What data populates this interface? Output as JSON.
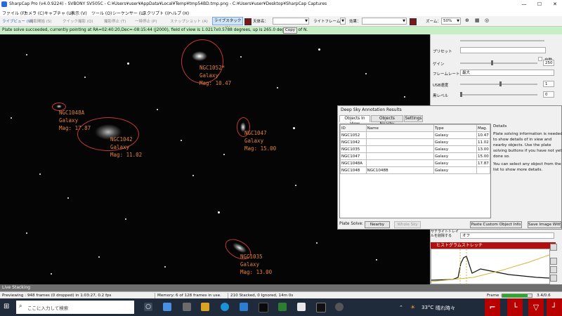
{
  "window": {
    "title": "SharpCap Pro (v4.0.9224) - SVBONY SV505C - C:¥Users¥user¥AppData¥Local¥Temp¥tmp54BD.tmp.png - C:¥Users¥user¥Desktop¥SharpCap Captures",
    "minimize": "—",
    "maximize": "☐",
    "close": "✕"
  },
  "menu": [
    "ファイル (F)",
    "カメラ (C)",
    "キャプチャ (U)",
    "表示 (V)",
    "ツール (O)",
    "シーケンサー (U)",
    "スクリプト (I)",
    "ヘルプ (H)"
  ],
  "toolbar": {
    "live_view": "ライブビュー (W)",
    "capture_start": "撮影開始 (S)",
    "quick_capture": "クイック撮影 (Q)",
    "capture_stop": "撮影停止 (T)",
    "pause": "一時停止 (P)",
    "snapshot": "スナップショット (A)",
    "live_stack": "ライブスタック (L)",
    "target_name": "天体名：",
    "live_frame": "ライトフレーム",
    "effect": "効果：",
    "zoom_label": "ズーム：",
    "zoom_value": "50%"
  },
  "notification": {
    "message": "Plate solve succeeded, currently pointing at RA=02:40:20,Dec=-08:15:44 (J2000), field of view is 1.0217x0.5788 degrees, up is 265.0 degrees E of N.",
    "copy_label": "Copy"
  },
  "annotations": [
    {
      "id": "ngc1052",
      "text": "NGC1052*\nGalaxy\nMag: 10.47"
    },
    {
      "id": "ngc1048a",
      "text": "NGC1048A\nGalaxy\nMag: 17.87"
    },
    {
      "id": "ngc1042",
      "text": "NGC1042\nGalaxy\nMag: 11.02"
    },
    {
      "id": "ngc1047",
      "text": "NGC1047\nGalaxy\nMag: 15.00"
    },
    {
      "id": "ngc1035",
      "text": "NGC1035\nGalaxy\nMag: 13.00"
    }
  ],
  "right_panel": {
    "preset_label": "プリセット",
    "auto_label": "自動",
    "gain_label": "ゲイン",
    "gain_value": "250",
    "frame_rate_label": "フレームレート",
    "frame_rate_value": "最大",
    "usb_label": "USB速度",
    "usb_value": "1",
    "black_level_label": "黒レベル",
    "black_level_value": "0",
    "satellite_label": "サテライトトレイルを削除する",
    "satellite_value": "オフ",
    "histogram_title": "ヒストグラムストレッチ"
  },
  "dialog": {
    "title": "Deep Sky Annotation Results",
    "tabs": [
      "Objects In View",
      "Objects Nearby",
      "Settings"
    ],
    "columns": [
      "ID",
      "Name",
      "Type",
      "Mag."
    ],
    "rows": [
      {
        "id": "NGC1052",
        "name": "",
        "type": "Galaxy",
        "mag": "10.47"
      },
      {
        "id": "NGC1042",
        "name": "",
        "type": "Galaxy",
        "mag": "11.02"
      },
      {
        "id": "NGC1035",
        "name": "",
        "type": "Galaxy",
        "mag": "13.00"
      },
      {
        "id": "NGC1047",
        "name": "",
        "type": "Galaxy",
        "mag": "15.00"
      },
      {
        "id": "NGC1048A",
        "name": "",
        "type": "Galaxy",
        "mag": "17.87"
      },
      {
        "id": "NGC1048",
        "name": "NGC1048B",
        "type": "Galaxy",
        "mag": ""
      }
    ],
    "details_heading": "Details",
    "details_text1": "Plate solving information is needed to show details of in view and nearby objects. Use the plate solving buttons if you have not yet done so.",
    "details_text2": "You can select any object from the list to show more details.",
    "plate_solve_label": "Plate Solve:",
    "nearby_button": "Nearby",
    "whole_sky_button": "Whole Sky",
    "paste_button": "Paste Custom Object Info",
    "save_button": "Save Image With"
  },
  "live_stacking_tab": "Live Stacking",
  "status": {
    "previewing": "Previewing : 948 frames (0 dropped) in 1:03:27, 0.2 fps",
    "memory": "Memory: 6 of 128 frames in use.",
    "stacked": "210 Stacked, 0 Ignored, 14m 0s",
    "frame_label": "Frame :",
    "frame_value": "3.4/0.6",
    "frame_progress": 0.85
  },
  "taskbar": {
    "search_placeholder": "ここに入力して検索",
    "temperature": "33°C",
    "weather": "晴れ時々"
  },
  "colors": {
    "annotation": "#e0803a",
    "ring": "#c23a3a",
    "notify_bg": "#c6efc6",
    "histogram_header": "#b01010"
  }
}
